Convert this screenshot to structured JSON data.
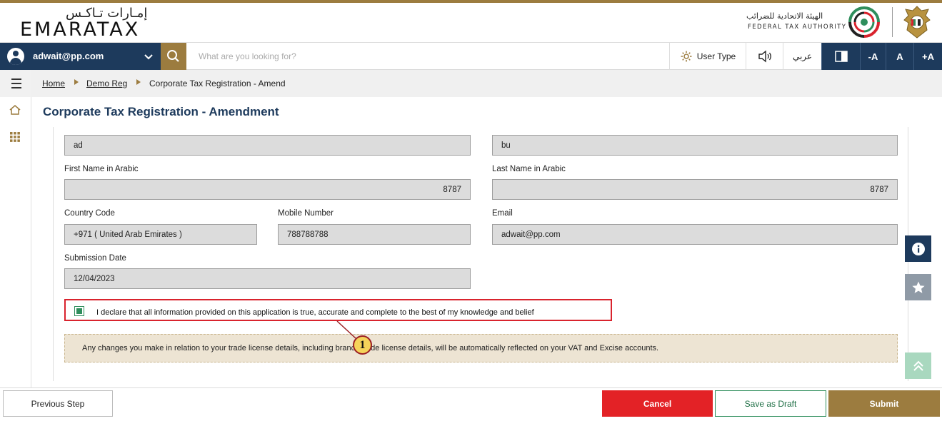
{
  "header": {
    "logo_arabic": "إمـارات تـاكـس",
    "logo_english": "EMARATAX",
    "fta_arabic": "الهيئة الاتحادية للضرائب",
    "fta_english": "FEDERAL TAX AUTHORITY"
  },
  "toolbar": {
    "user_email": "adwait@pp.com",
    "search_placeholder": "What are you looking for?",
    "user_type_label": "User Type",
    "language_label": "عربي",
    "font_decrease": "-A",
    "font_normal": "A",
    "font_increase": "+A"
  },
  "breadcrumb": {
    "home": "Home",
    "demo_reg": "Demo Reg",
    "current": "Corporate Tax Registration - Amend"
  },
  "page": {
    "title": "Corporate Tax Registration - Amendment"
  },
  "form": {
    "first_name_en_value": "ad",
    "last_name_en_value": "bu",
    "first_name_ar_label": "First Name in Arabic",
    "first_name_ar_value": "8787",
    "last_name_ar_label": "Last Name in Arabic",
    "last_name_ar_value": "8787",
    "country_code_label": "Country Code",
    "country_code_value": "+971 ( United Arab Emirates )",
    "mobile_label": "Mobile Number",
    "mobile_value": "788788788",
    "email_label": "Email",
    "email_value": "adwait@pp.com",
    "submission_date_label": "Submission Date",
    "submission_date_value": "12/04/2023",
    "declaration": "I declare that all information provided on this application is true, accurate and complete to the best of my knowledge and belief",
    "declaration_checked": true,
    "notice": "Any changes you make in relation to your trade license details, including branch trade license details, will be automatically reflected on your VAT and Excise accounts."
  },
  "callout": {
    "number": "1"
  },
  "footer": {
    "previous": "Previous Step",
    "cancel": "Cancel",
    "save_draft": "Save as Draft",
    "submit": "Submit"
  },
  "colors": {
    "primary_navy": "#1d3a5c",
    "accent_gold": "#9c7c3f",
    "cancel_red": "#e32226",
    "check_green": "#2f8e5c"
  },
  "icons": {
    "search": "search-icon",
    "user_type": "gear-icon",
    "audio": "speaker-icon",
    "contrast": "contrast-icon",
    "menu": "hamburger-icon",
    "home": "home-icon",
    "apps": "grid-icon",
    "info": "info-icon",
    "favorite": "star-icon",
    "scroll_top": "double-chevron-up-icon"
  }
}
